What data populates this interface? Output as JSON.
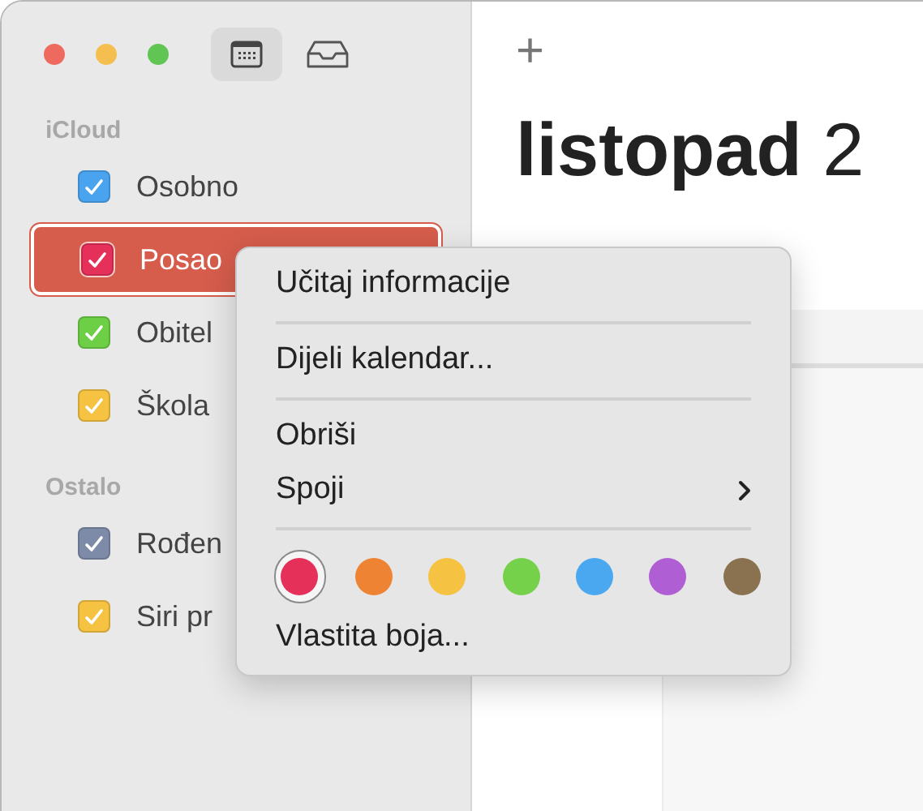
{
  "toolbar": {
    "buttons": [
      {
        "kind": "calendar",
        "selected": true
      },
      {
        "kind": "inbox",
        "selected": false
      }
    ]
  },
  "sidebar": {
    "groups": [
      {
        "title": "iCloud",
        "items": [
          {
            "label": "Osobno",
            "color": "#4aa3ee",
            "checked": true,
            "selected": false
          },
          {
            "label": "Posao",
            "color": "#e5305a",
            "checked": true,
            "selected": true
          },
          {
            "label": "Obitel",
            "color": "#6ccf45",
            "checked": true,
            "selected": false
          },
          {
            "label": "Škola",
            "color": "#f5c242",
            "checked": true,
            "selected": false
          }
        ]
      },
      {
        "title": "Ostalo",
        "items": [
          {
            "label": "Rođen",
            "color": "#7d8ba8",
            "checked": true,
            "selected": false
          },
          {
            "label": "Siri pr",
            "color": "#f5c242",
            "checked": true,
            "selected": false
          }
        ]
      }
    ]
  },
  "main": {
    "add_button": "+",
    "title": "**listopad** 2"
  },
  "context_menu": {
    "items": [
      {
        "kind": "item",
        "label": "Učitaj informacije"
      },
      {
        "kind": "separator"
      },
      {
        "kind": "item",
        "label": "Dijeli kalendar..."
      },
      {
        "kind": "separator"
      },
      {
        "kind": "item",
        "label": "Obriši"
      },
      {
        "kind": "submenu",
        "label": "Spoji"
      },
      {
        "kind": "separator"
      },
      {
        "kind": "colors",
        "colors": [
          {
            "color": "#e5305a",
            "selected": true
          },
          {
            "color": "#ee8433",
            "selected": false
          },
          {
            "color": "#f5c242",
            "selected": false
          },
          {
            "color": "#76d14a",
            "selected": false
          },
          {
            "color": "#4aa8f0",
            "selected": false
          },
          {
            "color": "#b05ed3",
            "selected": false
          },
          {
            "color": "#8a7150",
            "selected": false
          }
        ]
      },
      {
        "kind": "item",
        "label": "Vlastita boja..."
      }
    ]
  }
}
